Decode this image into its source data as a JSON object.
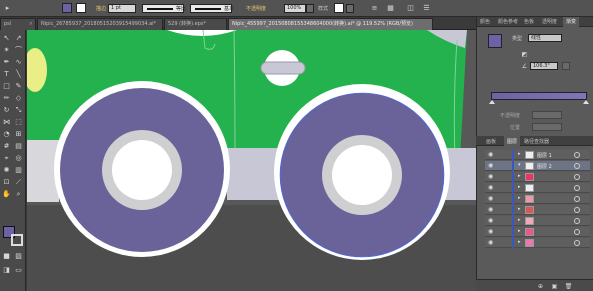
{
  "control_bar": {
    "stroke_label": "描边",
    "stroke_weight": "1 pt",
    "stroke_profile": "等比",
    "brush_label": "基本",
    "opacity_label": "不透明度",
    "opacity_value": "100%",
    "style_label": "样式",
    "colors": {
      "fill": "#6b63a6",
      "stroke": "#ffffff"
    }
  },
  "tabs": [
    {
      "label": "psl"
    },
    {
      "label": "Nipic_26785937_20180515203915499034.ai*"
    },
    {
      "label": "529 (转换).eps*"
    },
    {
      "label": "Nipic_455997_20150808155348604000(转换).ai* @ 119.52% (RGB/预览)"
    }
  ],
  "color_panel": {
    "tabs": [
      "颜色",
      "颜色参考",
      "色板",
      "透明度",
      "渐变"
    ],
    "type_label": "类型",
    "type_value": "线性",
    "angle_value": "106.3°",
    "opacity_label": "不透明度",
    "position_label": "位置"
  },
  "layers_panel": {
    "tabs": [
      "画板",
      "图层",
      "路径查找器"
    ],
    "rows": [
      {
        "name": "图层 1"
      },
      {
        "name": "图层 2"
      },
      {
        "name": ""
      },
      {
        "name": ""
      },
      {
        "name": ""
      },
      {
        "name": ""
      },
      {
        "name": ""
      },
      {
        "name": ""
      },
      {
        "name": ""
      }
    ]
  },
  "artwork_colors": {
    "body": "#23b24d",
    "wheel": "#6a6399",
    "hub_ring": "#cfcfd1",
    "bumper": "#c8c7d6",
    "road": "#4d4d4d",
    "headlight": "#e9ef86"
  }
}
